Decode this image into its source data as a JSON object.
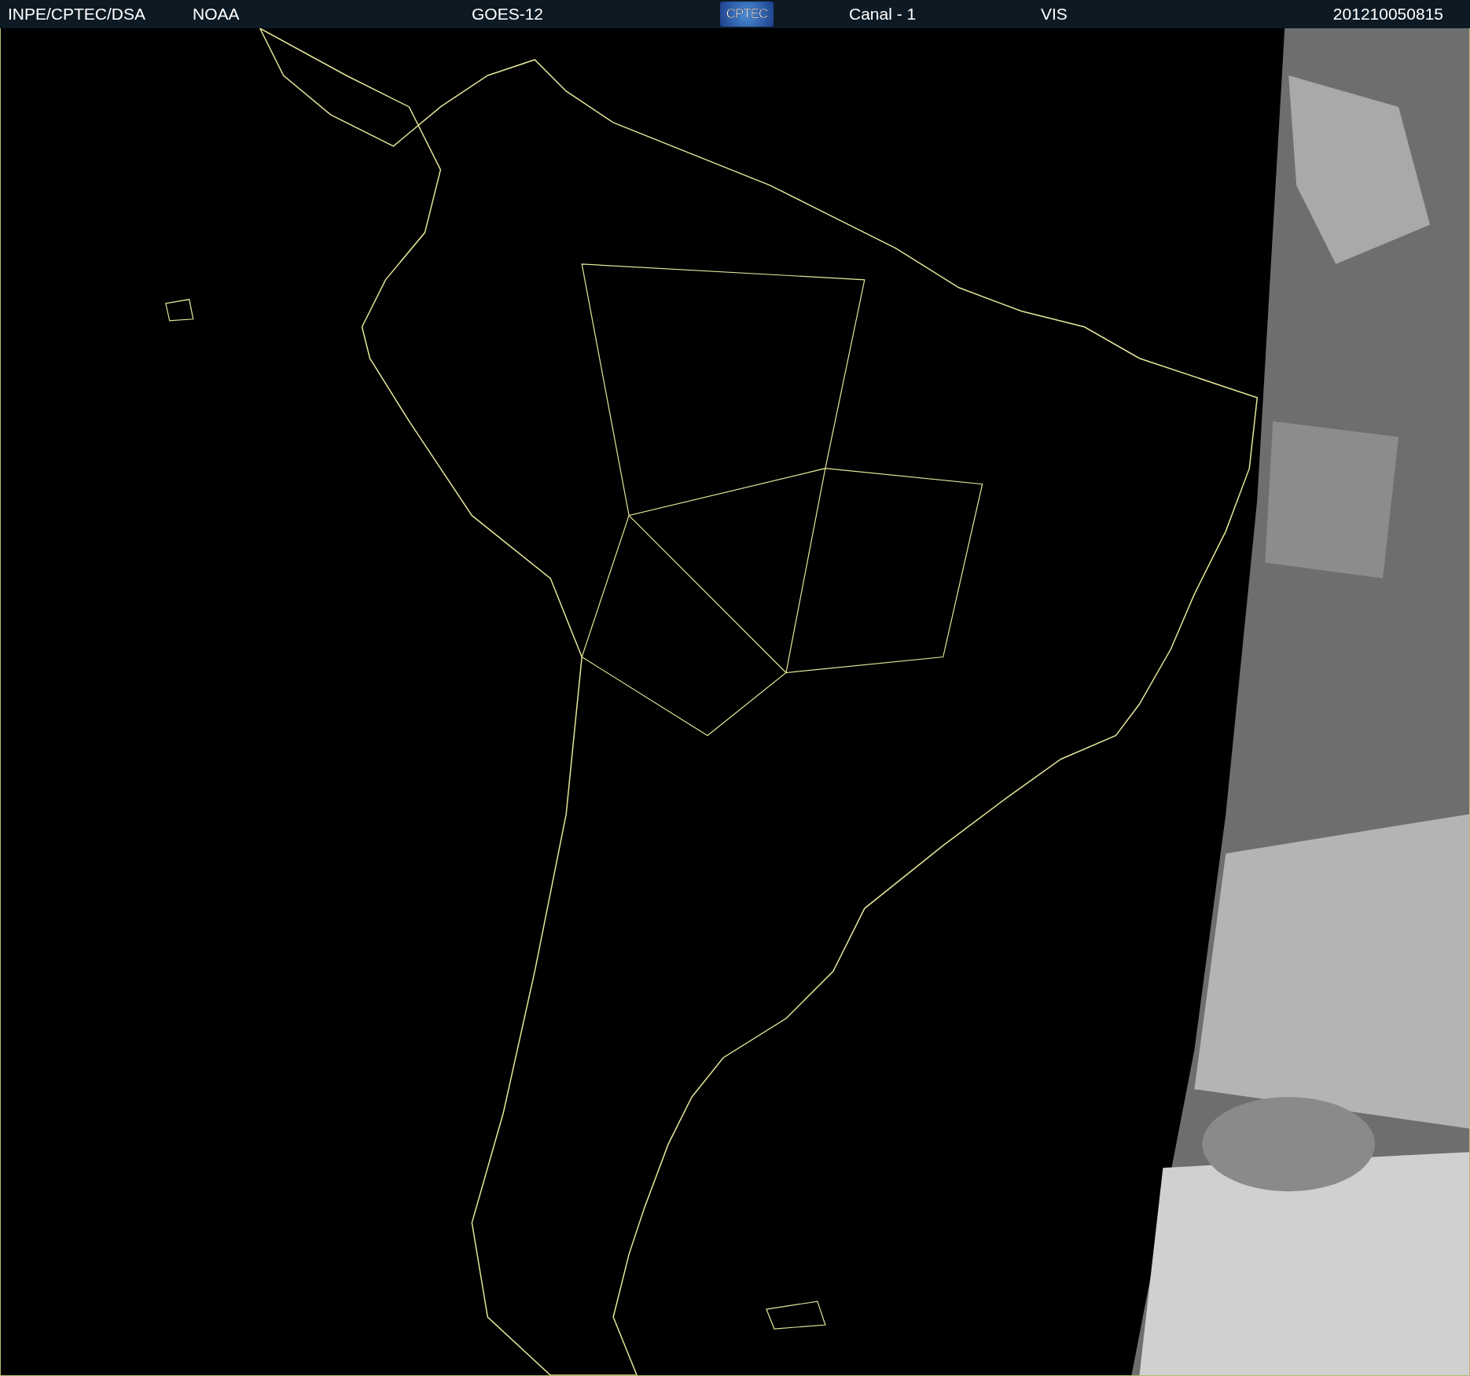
{
  "header": {
    "source": "INPE/CPTEC/DSA",
    "agency": "NOAA",
    "satellite": "GOES-12",
    "logo": "CPTEC",
    "channel": "Canal - 1",
    "band": "VIS",
    "timestamp": "201210050815"
  }
}
